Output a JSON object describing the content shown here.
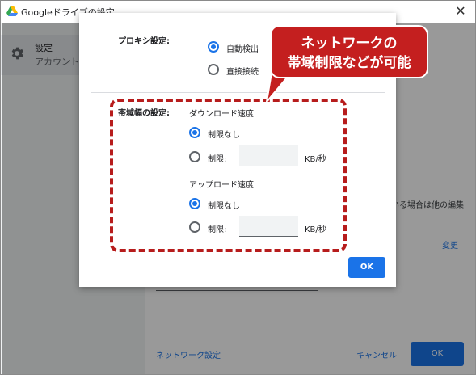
{
  "window": {
    "title": "Googleドライブの設定",
    "close": "✕"
  },
  "sidebar": {
    "items": [
      {
        "label": "設定",
        "sub": "アカウントな"
      }
    ]
  },
  "main": {
    "hint": "いる場合は他の編集",
    "change": "変更",
    "footer": {
      "network_settings": "ネットワーク設定",
      "cancel": "キャンセル",
      "ok": "OK"
    }
  },
  "dialog": {
    "proxy": {
      "label": "プロキシ設定:",
      "options": [
        "自動検出",
        "直接接続"
      ],
      "selected": 0
    },
    "bandwidth": {
      "label": "帯域幅の設定:",
      "download": {
        "title": "ダウンロード速度",
        "options": [
          "制限なし",
          "制限:"
        ],
        "selected": 0,
        "unit": "KB/秒",
        "value": ""
      },
      "upload": {
        "title": "アップロード速度",
        "options": [
          "制限なし",
          "制限:"
        ],
        "selected": 0,
        "unit": "KB/秒",
        "value": ""
      }
    },
    "ok": "OK"
  },
  "annotation": {
    "callout_lines": [
      "ネットワークの",
      "帯域制限などが可能"
    ]
  },
  "colors": {
    "accent": "#1a73e8",
    "callout": "#c41f1f",
    "dash": "#b71c1c"
  }
}
